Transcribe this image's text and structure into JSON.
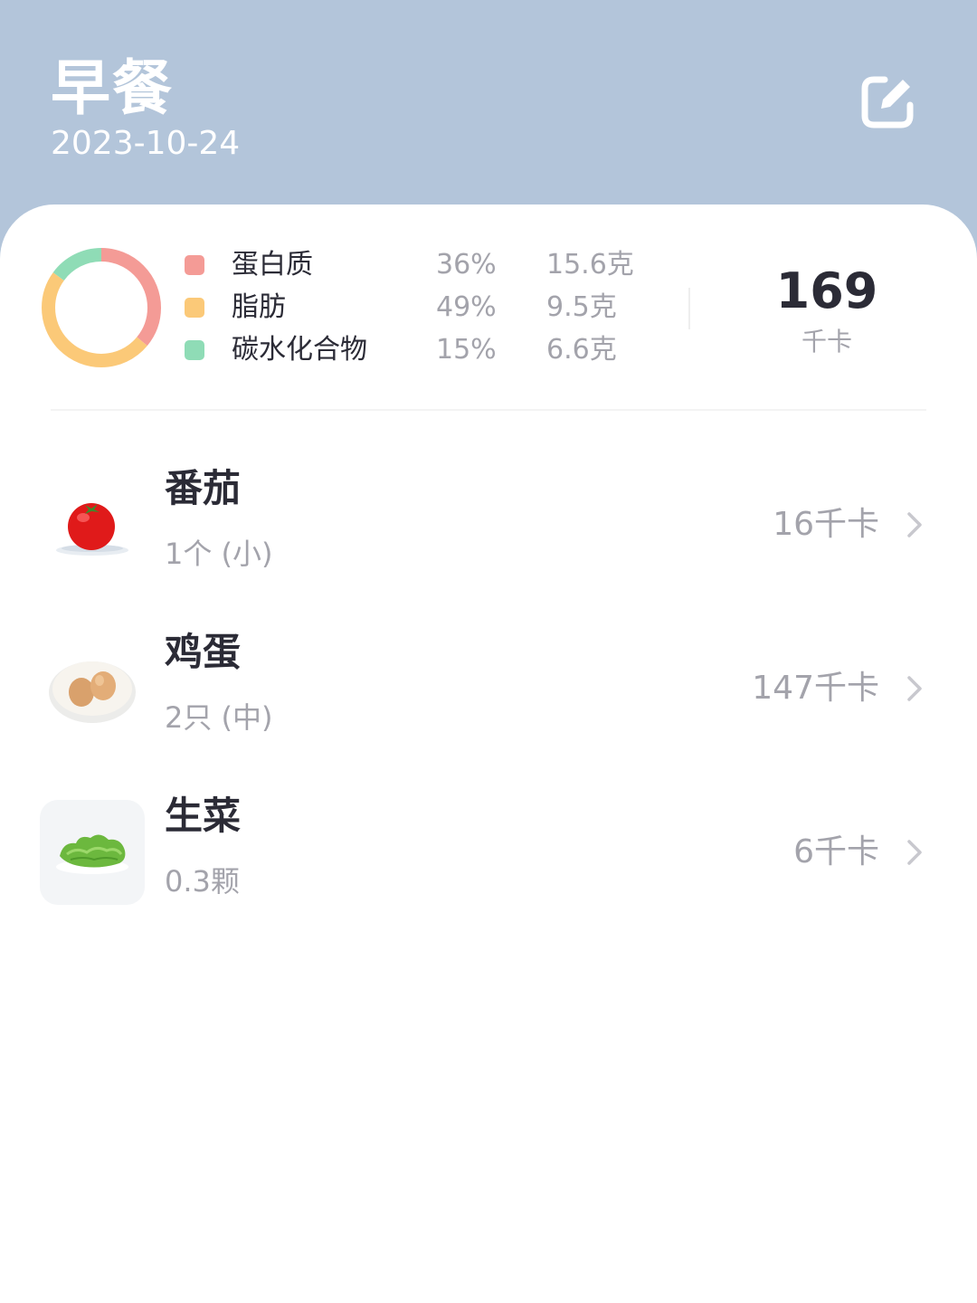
{
  "header": {
    "title": "早餐",
    "date": "2023-10-24"
  },
  "summary": {
    "nutrients": [
      {
        "name": "蛋白质",
        "percent": "36%",
        "grams": "15.6克",
        "color": "#f49b96"
      },
      {
        "name": "脂肪",
        "percent": "49%",
        "grams": "9.5克",
        "color": "#fbc978"
      },
      {
        "name": "碳水化合物",
        "percent": "15%",
        "grams": "6.6克",
        "color": "#8fdcb6"
      }
    ],
    "total_kcal": "169",
    "kcal_unit": "千卡"
  },
  "foods": [
    {
      "name": "番茄",
      "portion": "1个 (小)",
      "kcal": "16千卡",
      "icon": "tomato-icon"
    },
    {
      "name": "鸡蛋",
      "portion": "2只 (中)",
      "kcal": "147千卡",
      "icon": "egg-icon"
    },
    {
      "name": "生菜",
      "portion": "0.3颗",
      "kcal": "6千卡",
      "icon": "lettuce-icon"
    }
  ],
  "colors": {
    "header_bg": "#b3c5da",
    "text_primary": "#2b2b36",
    "text_secondary": "#a3a3ab"
  }
}
